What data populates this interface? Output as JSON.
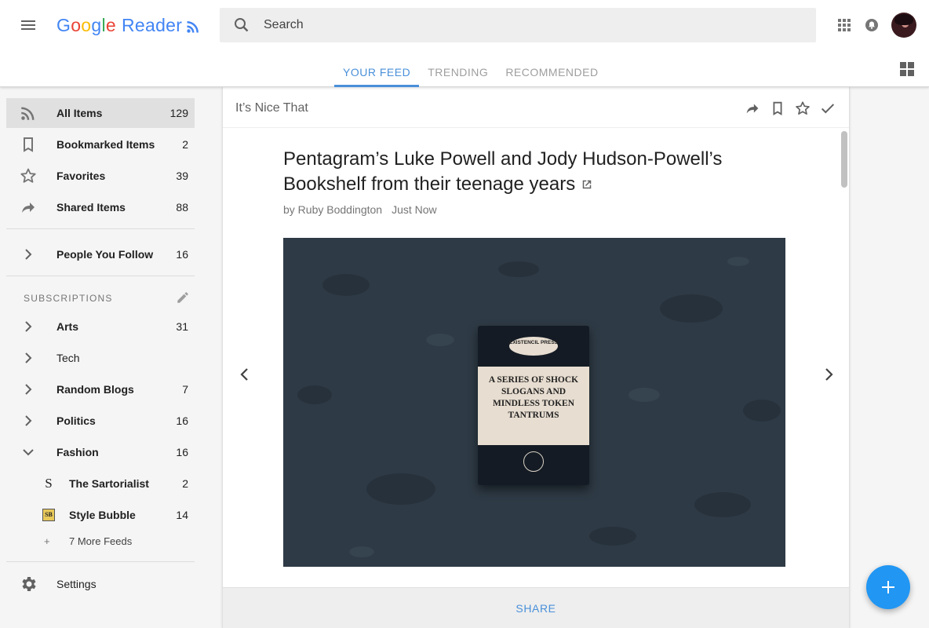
{
  "header": {
    "logo_google": [
      "G",
      "o",
      "o",
      "g",
      "l",
      "e"
    ],
    "logo_colors": [
      "#4285f4",
      "#ea4335",
      "#fbbc05",
      "#4285f4",
      "#34a853",
      "#ea4335"
    ],
    "logo_reader": "Reader",
    "search_placeholder": "Search",
    "tabs": [
      {
        "label": "YOUR FEED",
        "active": true
      },
      {
        "label": "TRENDING",
        "active": false
      },
      {
        "label": "RECOMMENDED",
        "active": false
      }
    ]
  },
  "sidebar": {
    "items": [
      {
        "icon": "rss-icon",
        "label": "All Items",
        "count": "129"
      },
      {
        "icon": "bookmark-icon",
        "label": "Bookmarked Items",
        "count": "2"
      },
      {
        "icon": "star-icon",
        "label": "Favorites",
        "count": "39"
      },
      {
        "icon": "share-icon",
        "label": "Shared Items",
        "count": "88"
      },
      {
        "icon": "chevron-right-icon",
        "label": "People You Follow",
        "count": "16"
      }
    ],
    "subscriptions_header": "SUBSCRIPTIONS",
    "folders": [
      {
        "label": "Arts",
        "count": "31"
      },
      {
        "label": "Tech",
        "count": ""
      },
      {
        "label": "Random Blogs",
        "count": "7"
      },
      {
        "label": "Politics",
        "count": "16"
      },
      {
        "label": "Fashion",
        "count": "16"
      }
    ],
    "feeds": [
      {
        "icon": "S",
        "label": "The Sartorialist",
        "count": "2"
      },
      {
        "icon": "SB",
        "label": "Style Bubble",
        "count": "14"
      }
    ],
    "more_feeds": "7 More Feeds",
    "settings_label": "Settings"
  },
  "article": {
    "source": "It’s Nice That",
    "title": "Pentagram’s Luke Powell and Jody Hudson-Powell’s Bookshelf from their teenage years",
    "author": "by Ruby Boddington",
    "time": "Just Now",
    "book_publisher": "EXISTENCIL PRESS",
    "book_text": "A SERIES OF SHOCK SLOGANS AND MINDLESS TOKEN TANTRUMS",
    "share_label": "SHARE"
  },
  "colors": {
    "accent": "#4a90d9",
    "fab": "#2196f3"
  }
}
